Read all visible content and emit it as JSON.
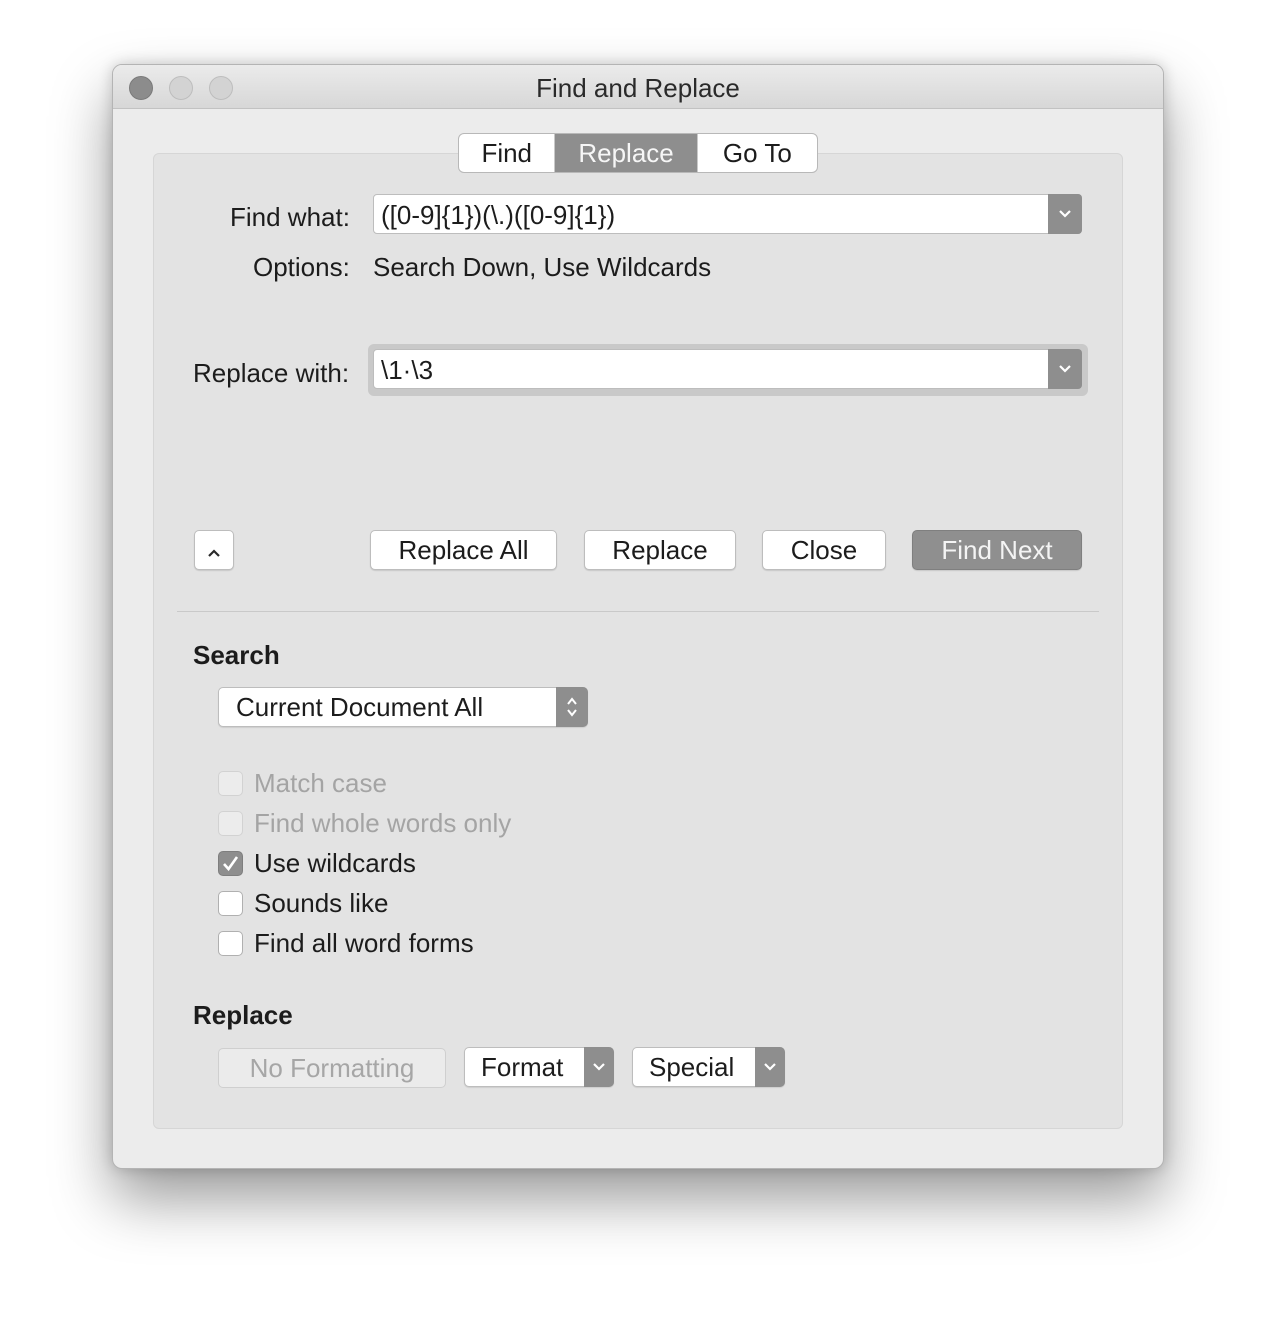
{
  "window": {
    "title": "Find and Replace"
  },
  "tabs": [
    {
      "label": "Find"
    },
    {
      "label": "Replace",
      "selected": true
    },
    {
      "label": "Go To"
    }
  ],
  "find": {
    "label": "Find what:",
    "value": "([0-9]{1})(\\.)([0-9]{1})"
  },
  "options": {
    "label": "Options:",
    "value": "Search Down, Use Wildcards"
  },
  "replace_field": {
    "label": "Replace with:",
    "value": "\\1·\\3"
  },
  "buttons": {
    "collapse_icon": "chevron-up-icon",
    "replace_all": "Replace All",
    "replace": "Replace",
    "close": "Close",
    "find_next": "Find Next"
  },
  "search_section": {
    "title": "Search",
    "scope": "Current Document All",
    "checkboxes": [
      {
        "label": "Match case",
        "checked": false,
        "enabled": false
      },
      {
        "label": "Find whole words only",
        "checked": false,
        "enabled": false
      },
      {
        "label": "Use wildcards",
        "checked": true,
        "enabled": true
      },
      {
        "label": "Sounds like",
        "checked": false,
        "enabled": true
      },
      {
        "label": "Find all word forms",
        "checked": false,
        "enabled": true
      }
    ]
  },
  "replace_section": {
    "title": "Replace",
    "no_formatting": "No Formatting",
    "format": "Format",
    "special": "Special"
  },
  "colors": {
    "accent_gray": "#8e8e8e",
    "window_bg": "#ececec",
    "panel_bg": "#e3e3e3"
  }
}
